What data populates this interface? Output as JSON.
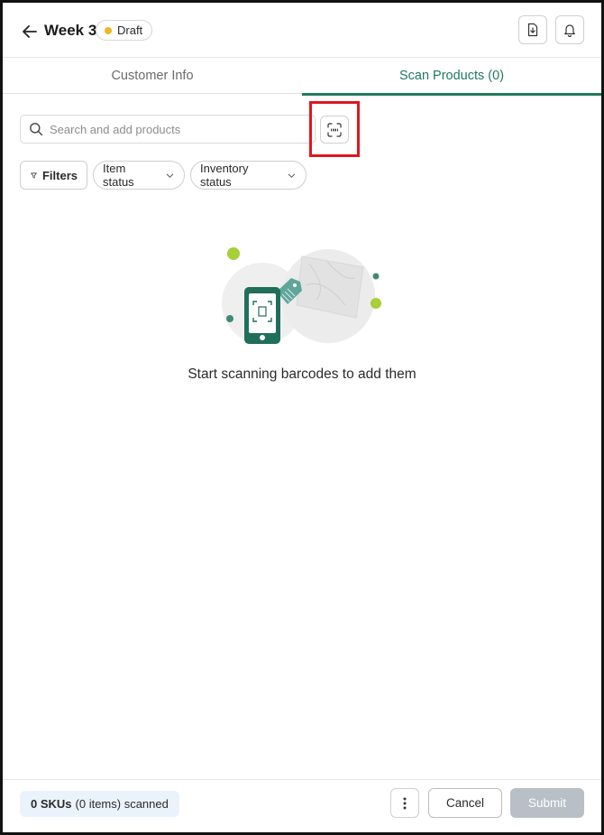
{
  "header": {
    "title": "Week 3",
    "status_badge": "Draft",
    "icons": {
      "back": "arrow-left-icon",
      "download": "file-download-icon",
      "notifications": "bell-icon"
    },
    "colors": {
      "draft_dot": "#f0b429"
    }
  },
  "tabs": [
    {
      "label": "Customer Info",
      "active": false
    },
    {
      "label": "Scan Products (0)",
      "active": true
    }
  ],
  "search": {
    "placeholder": "Search and add products",
    "value": "",
    "icons": {
      "search": "search-icon",
      "scan": "barcode-scan-icon"
    }
  },
  "filters": {
    "filters_label": "Filters",
    "item_status_label": "Item status",
    "inventory_status_label": "Inventory status"
  },
  "empty_state": {
    "message": "Start scanning barcodes to add them"
  },
  "footer": {
    "sku_count": "0 SKUs",
    "items_text": "(0 items) scanned",
    "cancel_label": "Cancel",
    "submit_label": "Submit"
  },
  "colors": {
    "accent": "#1f7a5a",
    "highlight": "#e0161e",
    "submit_disabled": "#b9bfc6"
  }
}
